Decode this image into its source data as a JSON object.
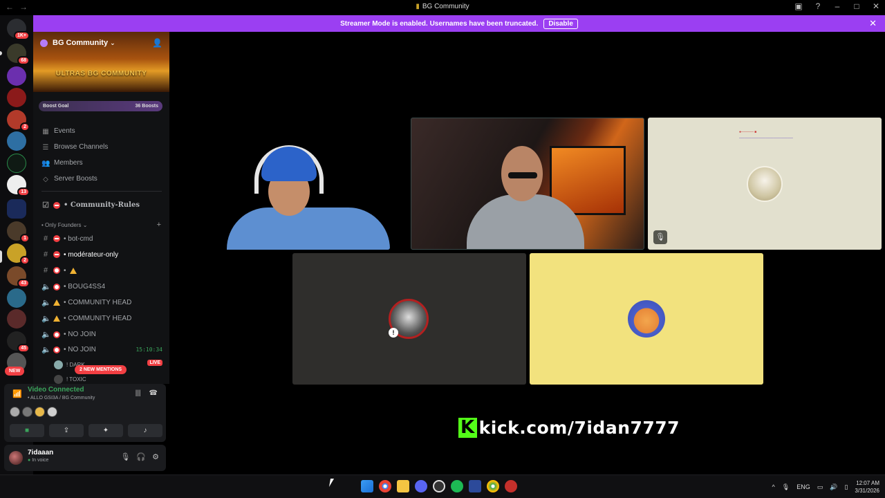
{
  "window": {
    "title": "BG Community",
    "icons": [
      "back-arrow",
      "forward-arrow",
      "inbox-icon",
      "help-icon",
      "minimize-icon",
      "maximize-icon",
      "close-icon"
    ]
  },
  "banner": {
    "text": "Streamer Mode is enabled. Usernames have been truncated.",
    "button": "Disable",
    "bg_color": "#9b3ff2"
  },
  "server_rail": {
    "badges": [
      "1K+",
      "68",
      "2",
      "13",
      "1",
      "2",
      "43",
      "45"
    ],
    "new_label": "NEW"
  },
  "guild": {
    "name": "BG Community",
    "banner_text": "ULTRAS BG COMMUNITY",
    "boost_goal": "Boost Goal",
    "boost_count": "36 Boosts",
    "nav": [
      "Events",
      "Browse Channels",
      "Members",
      "Server Boosts"
    ],
    "rules_channel": "• Community-Rules",
    "category": "• Only Founders",
    "channels": [
      {
        "type": "text",
        "name": "• bot-cmd"
      },
      {
        "type": "text",
        "name": "• modérateur-only"
      },
      {
        "type": "text",
        "name": "•"
      },
      {
        "type": "voice",
        "name": "• BOUG4SS4"
      },
      {
        "type": "voice",
        "name": "• COMMUNITY HEAD"
      },
      {
        "type": "voice",
        "name": "• COMMUNITY HEAD"
      },
      {
        "type": "voice",
        "name": "• NO JOIN"
      },
      {
        "type": "voice",
        "name": "• NO JOIN",
        "timer": "15:10:34"
      }
    ],
    "voice_users": [
      "! DARK",
      "! TOXIC"
    ],
    "live_label": "LIVE",
    "mentions": "2 NEW MENTIONS"
  },
  "voice": {
    "status": "Video Connected",
    "location": "• ALLO GSI3A / BG Community"
  },
  "user": {
    "name": "7idaaan",
    "status": "In voice"
  },
  "watermark": {
    "k": "K",
    "text": "kick.com/7idan7777"
  },
  "taskbar": {
    "lang": "ENG",
    "time": "12:07 AM",
    "date": "3/31/2026"
  }
}
